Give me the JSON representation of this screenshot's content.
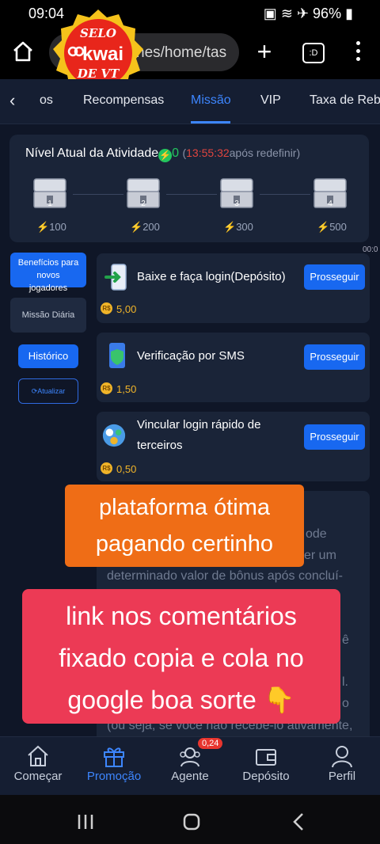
{
  "status_bar": {
    "time": "09:04",
    "battery": "96%"
  },
  "browser": {
    "url": "nes/home/tas",
    "tabs_count": ":D"
  },
  "badge": {
    "line1": "SELO",
    "brand": "kwai",
    "line3": "DE VT"
  },
  "nav_tabs": [
    {
      "label": "os"
    },
    {
      "label": "Recompensas"
    },
    {
      "label": "Missão"
    },
    {
      "label": "VIP"
    },
    {
      "label": "Taxa de Reba"
    }
  ],
  "activity": {
    "title": "Nível Atual da Atividade",
    "points": "0",
    "timer": "13:55:32",
    "timer_suffix": "após redefinir",
    "chests": [
      {
        "number": "1",
        "label": "100"
      },
      {
        "number": "2",
        "label": "200"
      },
      {
        "number": "3",
        "label": "300"
      },
      {
        "number": "4",
        "label": "500"
      }
    ],
    "side_mark": "00:0"
  },
  "sidebar": {
    "new_players": "Benefícios para novos jogadores",
    "daily": "Missão Diária",
    "history": "Histórico",
    "refresh": "Atualizar"
  },
  "tasks": [
    {
      "title": "Baixe e faça login(Depósito)",
      "reward": "5,00",
      "button": "Prosseguir"
    },
    {
      "title": "Verificação por SMS",
      "reward": "1,50",
      "button": "Prosseguir"
    },
    {
      "title_line1": "Vincular login rápido de",
      "title_line2": "terceiros",
      "reward": "0,50",
      "button": "Prosseguir"
    }
  ],
  "currency_symbol": "R$",
  "description": {
    "fragment1": "ode",
    "fragment2": "er um",
    "line3": "determinado valor de bônus após concluí-",
    "fragment4": "ê",
    "fragment5": "l.",
    "fragment6": "o",
    "line7": "(ou seja, se você não recebê-lo ativamente,"
  },
  "overlay_orange": {
    "line1": "plataforma ótima",
    "line2": "pagando certinho"
  },
  "overlay_red": {
    "line1": "link nos comentários",
    "line2": "fixado copia e cola no",
    "line3": "google boa sorte 👇"
  },
  "bottom_nav": [
    {
      "label": "Começar"
    },
    {
      "label": "Promoção"
    },
    {
      "label": "Agente",
      "badge": "0,24"
    },
    {
      "label": "Depósito"
    },
    {
      "label": "Perfil"
    }
  ],
  "colors": {
    "accent": "#3d86ff",
    "button": "#1868f0",
    "orange": "#ef6d16",
    "red": "#ec3a55",
    "coin": "#f0b429",
    "timer": "#e0453f",
    "bolt": "#22c55e"
  }
}
